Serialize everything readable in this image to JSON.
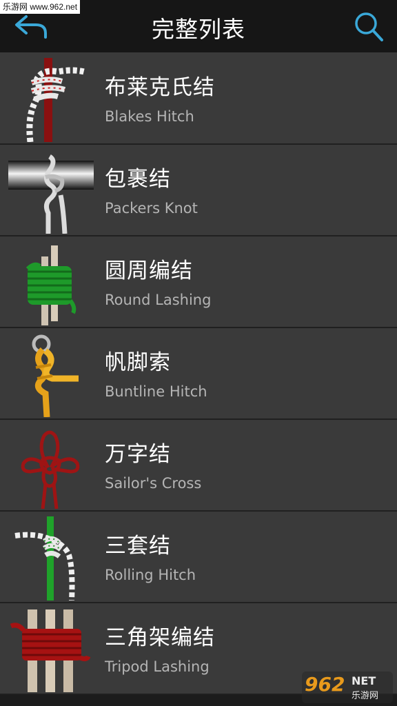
{
  "header": {
    "title": "完整列表",
    "watermark": "乐游网 www.962.net"
  },
  "colors": {
    "header_bg": "#161616",
    "row_bg": "#3a3a3a",
    "accent_icon": "#3aa8d8"
  },
  "items": [
    {
      "cn": "布莱克氏结",
      "en": "Blakes Hitch",
      "icon": "blakes-hitch-knot-image"
    },
    {
      "cn": "包裹结",
      "en": "Packers Knot",
      "icon": "packers-knot-image"
    },
    {
      "cn": "圆周编结",
      "en": "Round Lashing",
      "icon": "round-lashing-image"
    },
    {
      "cn": "帆脚索",
      "en": "Buntline Hitch",
      "icon": "buntline-hitch-image"
    },
    {
      "cn": "万字结",
      "en": "Sailor's Cross",
      "icon": "sailors-cross-image"
    },
    {
      "cn": "三套结",
      "en": "Rolling Hitch",
      "icon": "rolling-hitch-image"
    },
    {
      "cn": "三角架编结",
      "en": "Tripod Lashing",
      "icon": "tripod-lashing-image"
    }
  ],
  "watermark_bottom": {
    "logo": "962",
    "net": "NET",
    "sub": "乐游网"
  }
}
